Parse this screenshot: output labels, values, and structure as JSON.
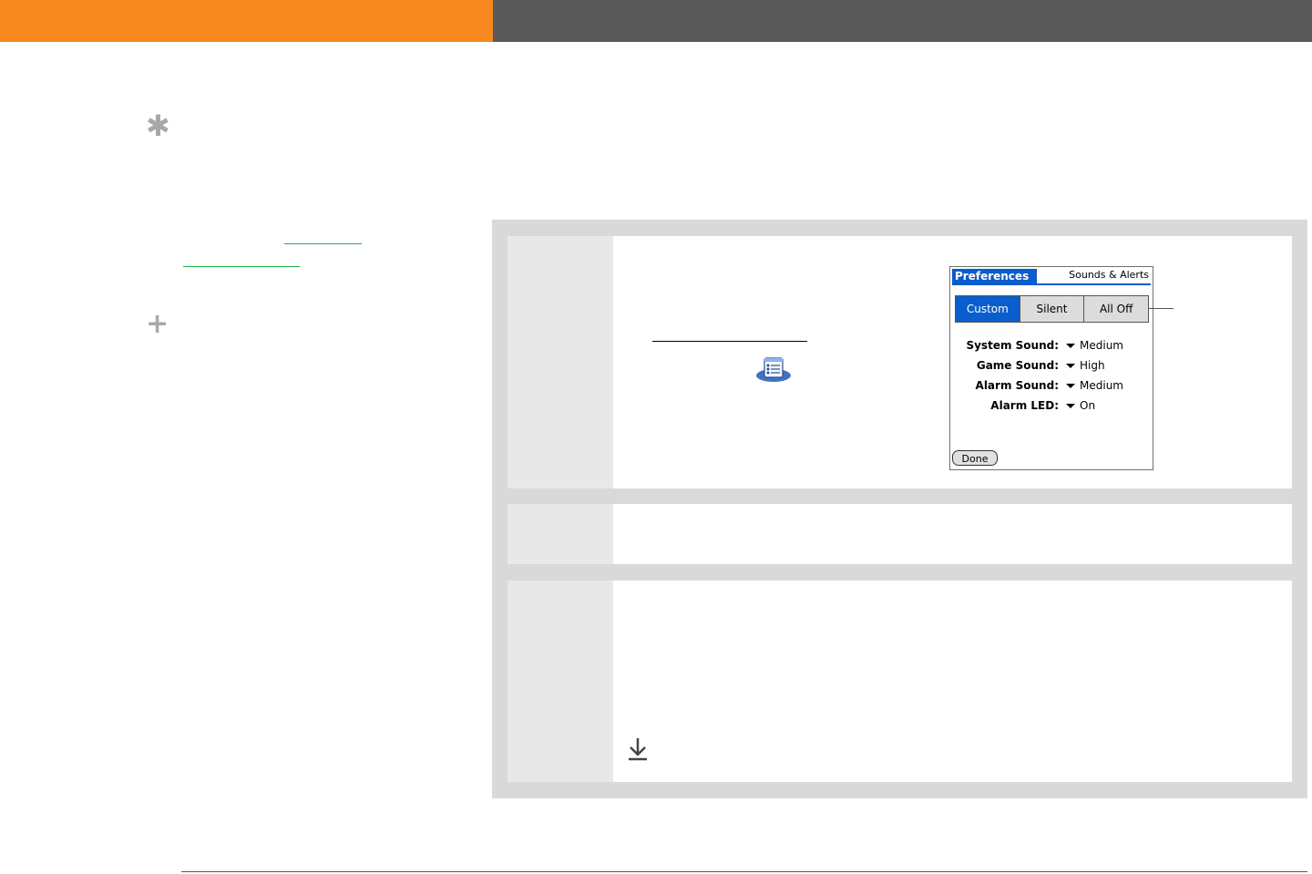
{
  "palm_screen": {
    "app_title": "Preferences",
    "category": "Sounds & Alerts",
    "profiles": [
      "Custom",
      "Silent",
      "All Off"
    ],
    "selected_profile": "Custom",
    "settings": [
      {
        "label": "System Sound:",
        "value": "Medium"
      },
      {
        "label": "Game Sound:",
        "value": "High"
      },
      {
        "label": "Alarm Sound:",
        "value": "Medium"
      },
      {
        "label": "Alarm LED:",
        "value": "On"
      }
    ],
    "done_label": "Done",
    "accent_color": "#0a5ecb"
  },
  "colors": {
    "header_orange": "#f7891e",
    "header_gray": "#595959",
    "link_green": "#22b14c",
    "panel_gray": "#d9d9d9"
  },
  "icons": {
    "tip": "asterisk-icon",
    "did_you_know": "plus-icon",
    "app": "preferences-app-icon",
    "continue": "arrow-down-to-line-icon"
  }
}
